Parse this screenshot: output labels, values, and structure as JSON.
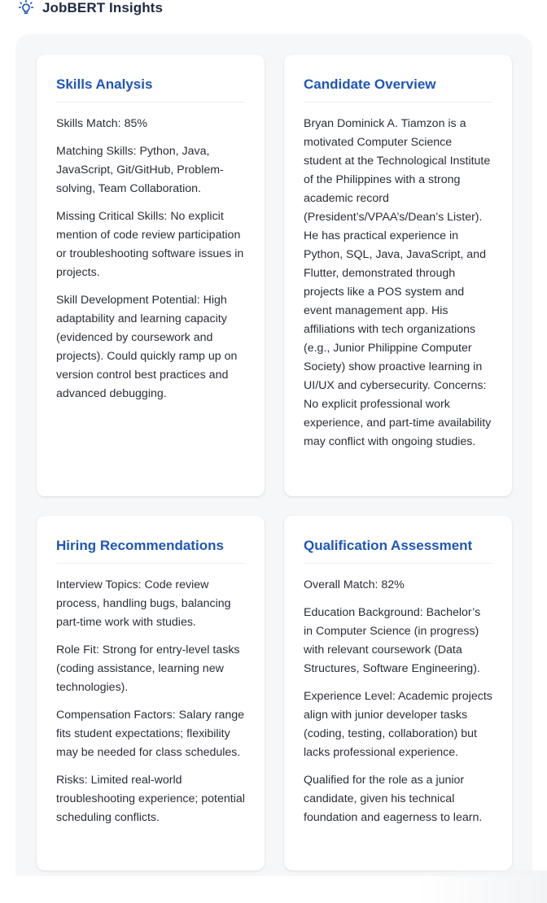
{
  "header": {
    "icon": "lightbulb-icon",
    "title": "JobBERT Insights",
    "accent_color": "#1e56b8"
  },
  "cards": {
    "skills": {
      "title": "Skills Analysis",
      "paragraphs": [
        "Skills Match: 85%",
        "Matching Skills: Python, Java, JavaScript, Git/GitHub, Problem-solving, Team Collaboration.",
        "Missing Critical Skills: No explicit mention of code review participation or troubleshooting software issues in projects.",
        "Skill Development Potential: High adaptability and learning capacity (evidenced by coursework and projects). Could quickly ramp up on version control best practices and advanced debugging."
      ]
    },
    "overview": {
      "title": "Candidate Overview",
      "paragraphs": [
        "Bryan Dominick A. Tiamzon is a motivated Computer Science student at the Technological Institute of the Philippines with a strong academic record (President’s/VPAA’s/Dean’s Lister). He has practical experience in Python, SQL, Java, JavaScript, and Flutter, demonstrated through projects like a POS system and event management app. His affiliations with tech organizations (e.g., Junior Philippine Computer Society) show proactive learning in UI/UX and cybersecurity. Concerns: No explicit professional work experience, and part-time availability may conflict with ongoing studies."
      ]
    },
    "hiring": {
      "title": "Hiring Recommendations",
      "paragraphs": [
        "Interview Topics: Code review process, handling bugs, balancing part-time work with studies.",
        "Role Fit: Strong for entry-level tasks (coding assistance, learning new technologies).",
        "Compensation Factors: Salary range fits student expectations; flexibility may be needed for class schedules.",
        "Risks: Limited real-world troubleshooting experience; potential scheduling conflicts."
      ]
    },
    "qualification": {
      "title": "Qualification Assessment",
      "paragraphs": [
        "Overall Match: 82%",
        "Education Background: Bachelor’s in Computer Science (in progress) with relevant coursework (Data Structures, Software Engineering).",
        "Experience Level: Academic projects align with junior developer tasks (coding, testing, collaboration) but lacks professional experience.",
        "Qualified for the role as a junior candidate, given his technical foundation and eagerness to learn."
      ]
    }
  }
}
